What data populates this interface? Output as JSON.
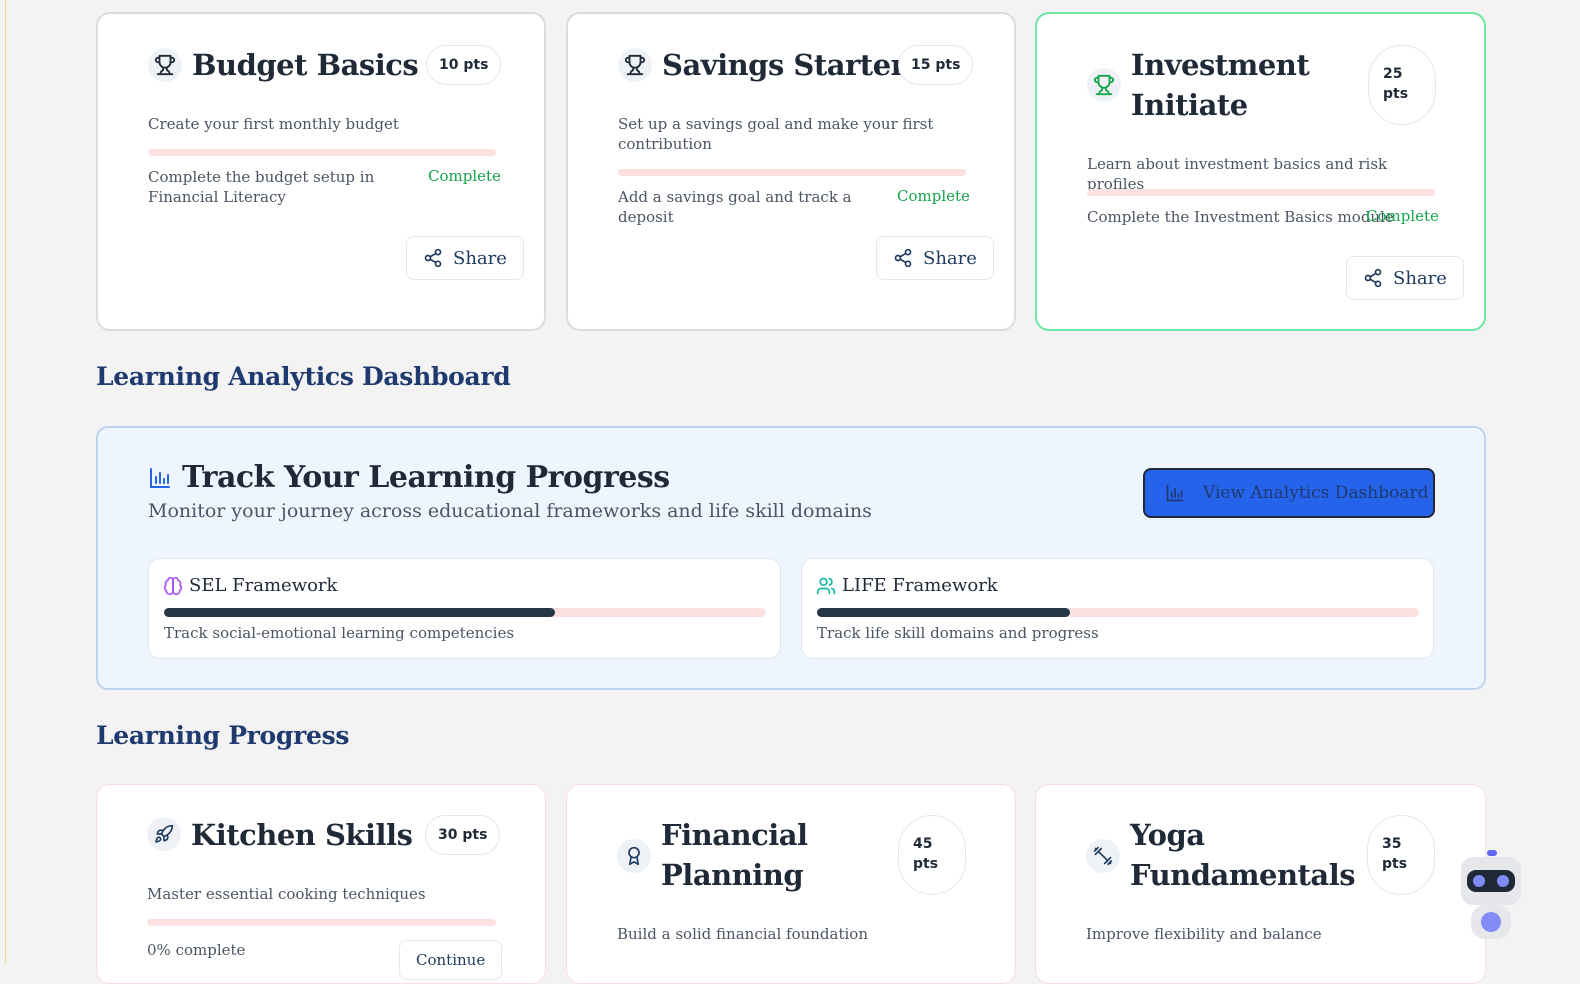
{
  "achievements": [
    {
      "title_lines": [
        "Budget Basics"
      ],
      "points": "10 pts",
      "description": "Create your first monthly budget",
      "task": "Complete the budget setup in Financial Literacy",
      "status": "Complete",
      "share": "Share",
      "progress": 0.0
    },
    {
      "title_lines": [
        "Savings Starter"
      ],
      "points": "15 pts",
      "description": "Set up a savings goal and make your first contribution",
      "task": "Add a savings goal and track a deposit",
      "status": "Complete",
      "share": "Share",
      "progress": 0.0
    },
    {
      "title_lines": [
        "Investment",
        "Initiate"
      ],
      "points_lines": [
        "25",
        "pts"
      ],
      "description": "Learn about investment basics and risk profiles",
      "task": "Complete the Investment Basics module",
      "status": "Complete",
      "share": "Share",
      "progress": 0.0
    }
  ],
  "analytics_section": {
    "heading": "Learning Analytics Dashboard"
  },
  "analytics": {
    "title": "Track Your Learning Progress",
    "subtitle": "Monitor your journey across educational frameworks and life skill domains",
    "button": "View Analytics Dashboard",
    "frameworks": [
      {
        "name": "SEL Framework",
        "description": "Track social-emotional learning competencies",
        "progress": 0.65
      },
      {
        "name": "LIFE Framework",
        "description": "Track life skill domains and progress",
        "progress": 0.42
      }
    ]
  },
  "progress_section": {
    "heading": "Learning Progress"
  },
  "courses": [
    {
      "title_lines": [
        "Kitchen Skills"
      ],
      "points": "30 pts",
      "description": "Master essential cooking techniques",
      "progress_text": "0% complete",
      "button": "Continue",
      "progress": 0.0
    },
    {
      "title_lines": [
        "Financial",
        "Planning"
      ],
      "points_lines": [
        "45",
        "pts"
      ],
      "description": "Build a solid financial foundation"
    },
    {
      "title_lines": [
        "Yoga",
        "Fundamentals"
      ],
      "points_lines": [
        "35",
        "pts"
      ],
      "description": "Improve flexibility and balance"
    }
  ],
  "colors": {
    "accent": "#2563eb",
    "complete": "#16a34a",
    "heading": "#1e3a6e",
    "progress_fill": "#253745",
    "progress_track": "#fde1e1"
  },
  "icons": {
    "achievement": "trophy-icon",
    "share": "share-icon",
    "analytics": "bar-chart-icon",
    "sel": "brain-icon",
    "life": "users-icon",
    "kitchen": "rocket-icon",
    "financial": "award-icon",
    "yoga": "dumbbell-icon",
    "assistant": "robot-icon"
  }
}
